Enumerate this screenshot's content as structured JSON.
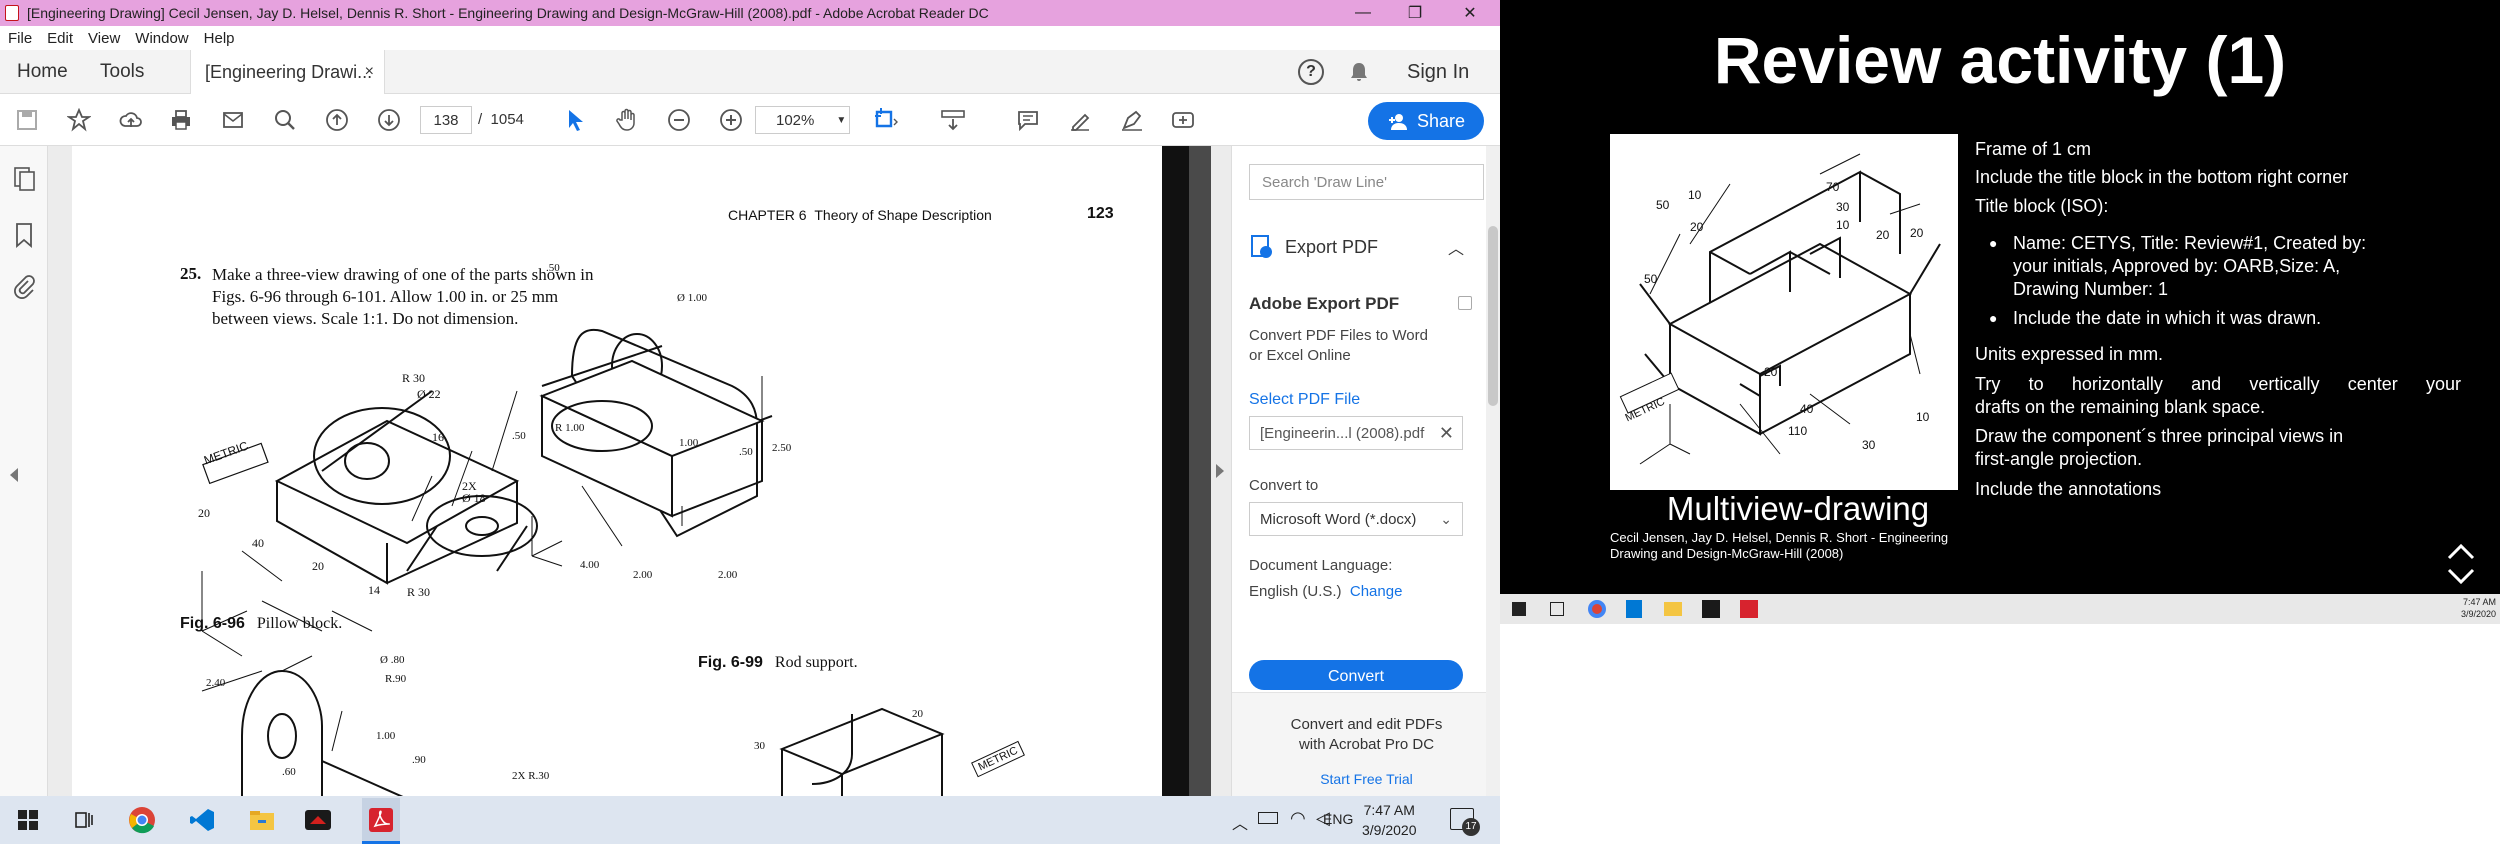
{
  "window": {
    "title": "[Engineering Drawing] Cecil Jensen, Jay D. Helsel, Dennis R. Short - Engineering Drawing and Design-McGraw-Hill (2008).pdf - Adobe Acrobat Reader DC",
    "minimize": "—",
    "restore": "❐",
    "close": "✕"
  },
  "menu": [
    "File",
    "Edit",
    "View",
    "Window",
    "Help"
  ],
  "tabs": {
    "home": "Home",
    "tools": "Tools",
    "doc": "[Engineering Drawi...",
    "close": "×",
    "help": "?",
    "signin": "Sign In"
  },
  "toolbar": {
    "page_current": "138",
    "page_sep": "/",
    "page_total": "1054",
    "zoom": "102%",
    "share": "Share"
  },
  "pdf": {
    "header_chapter": "CHAPTER 6",
    "header_title": "Theory of Shape Description",
    "header_page": "123",
    "problem_num": "25.",
    "problem_lines": [
      "Make a three-view drawing of one of the parts shown in",
      "Figs. 6-96 through 6-101. Allow 1.00 in. or 25 mm",
      "between views. Scale 1:1. Do not dimension."
    ],
    "fig96_label": "Fig. 6-96",
    "fig96_caption": "Pillow block.",
    "fig99_label": "Fig. 6-99",
    "fig99_caption": "Rod support.",
    "dims_pillow": {
      "metric": "METRIC",
      "r30": "R 30",
      "d22": "Ø 22",
      "d16": "16",
      "d20a": "20",
      "d40": "40",
      "d20b": "20",
      "d14": "14",
      "r30b": "R 30",
      "twox": "2X",
      "d18": "Ø 18"
    },
    "dims_rod": {
      "r50": ".50",
      "d100": "Ø 1.00",
      "r100": "R 1.00",
      "p50a": ".50",
      "p100": "1.00",
      "p50b": ".50",
      "p250": "2.50",
      "p400": "4.00",
      "p200a": "2.00",
      "p200b": "2.00"
    },
    "dims_bottom": {
      "d80": "Ø .80",
      "r90": "R.90",
      "p240": "2.40",
      "p100": "1.00",
      "p90": ".90",
      "p60": ".60",
      "r30": "2X  R.30",
      "p30": "30",
      "p20": "20",
      "metric": "METRIC"
    }
  },
  "rpanel": {
    "search_placeholder": "Search 'Draw Line'",
    "export_title": "Export PDF",
    "adobe_export": "Adobe Export PDF",
    "desc_line1": "Convert PDF Files to Word",
    "desc_line2": "or Excel Online",
    "select_file": "Select PDF File",
    "file_name": "[Engineerin...l (2008).pdf",
    "convert_to": "Convert to",
    "format": "Microsoft Word (*.docx)",
    "doc_lang": "Document Language:",
    "lang_value": "English (U.S.)",
    "change": "Change",
    "convert_btn": "Convert",
    "promo_line1": "Convert and edit PDFs",
    "promo_line2": "with Acrobat Pro DC",
    "trial": "Start Free Trial"
  },
  "taskbar": {
    "lang": "ENG",
    "time": "7:47 AM",
    "date": "3/9/2020",
    "notif": "17"
  },
  "slide": {
    "title": "Review activity (1)",
    "caption": "Multiview-drawing",
    "cite_line1": "Cecil Jensen, Jay D. Helsel, Dennis R. Short - Engineering",
    "cite_line2": "Drawing and Design-McGraw-Hill (2008)",
    "p1": "Frame of 1 cm",
    "p2": "Include the title block in the bottom right corner",
    "p3": "Title block (ISO):",
    "b1_l1": "Name: CETYS, Title: Review#1, Created by:",
    "b1_l2": "your initials, Approved by: OARB,Size: A,",
    "b1_l3": "Drawing Number: 1",
    "b2": "Include the date in which it was drawn.",
    "p4": "Units expressed in mm.",
    "p5_l1": "Try to horizontally and vertically center your",
    "p5_l2": "drafts on the remaining blank space.",
    "p6_l1": "Draw the component´s three principal views in",
    "p6_l2": "first-angle projection.",
    "p7": "Include the annotations",
    "img_dims": {
      "d50a": "50",
      "d10a": "10",
      "d70": "70",
      "d30a": "30",
      "d20a": "20",
      "d10b": "10",
      "d20b": "20",
      "d20c": "20",
      "d50b": "50",
      "d20d": "20",
      "d40": "40",
      "d110": "110",
      "d30b": "30",
      "d10c": "10",
      "metric": "METRIC"
    }
  },
  "slide_taskbar": {
    "time": "7:47 AM",
    "date": "3/9/2020"
  }
}
